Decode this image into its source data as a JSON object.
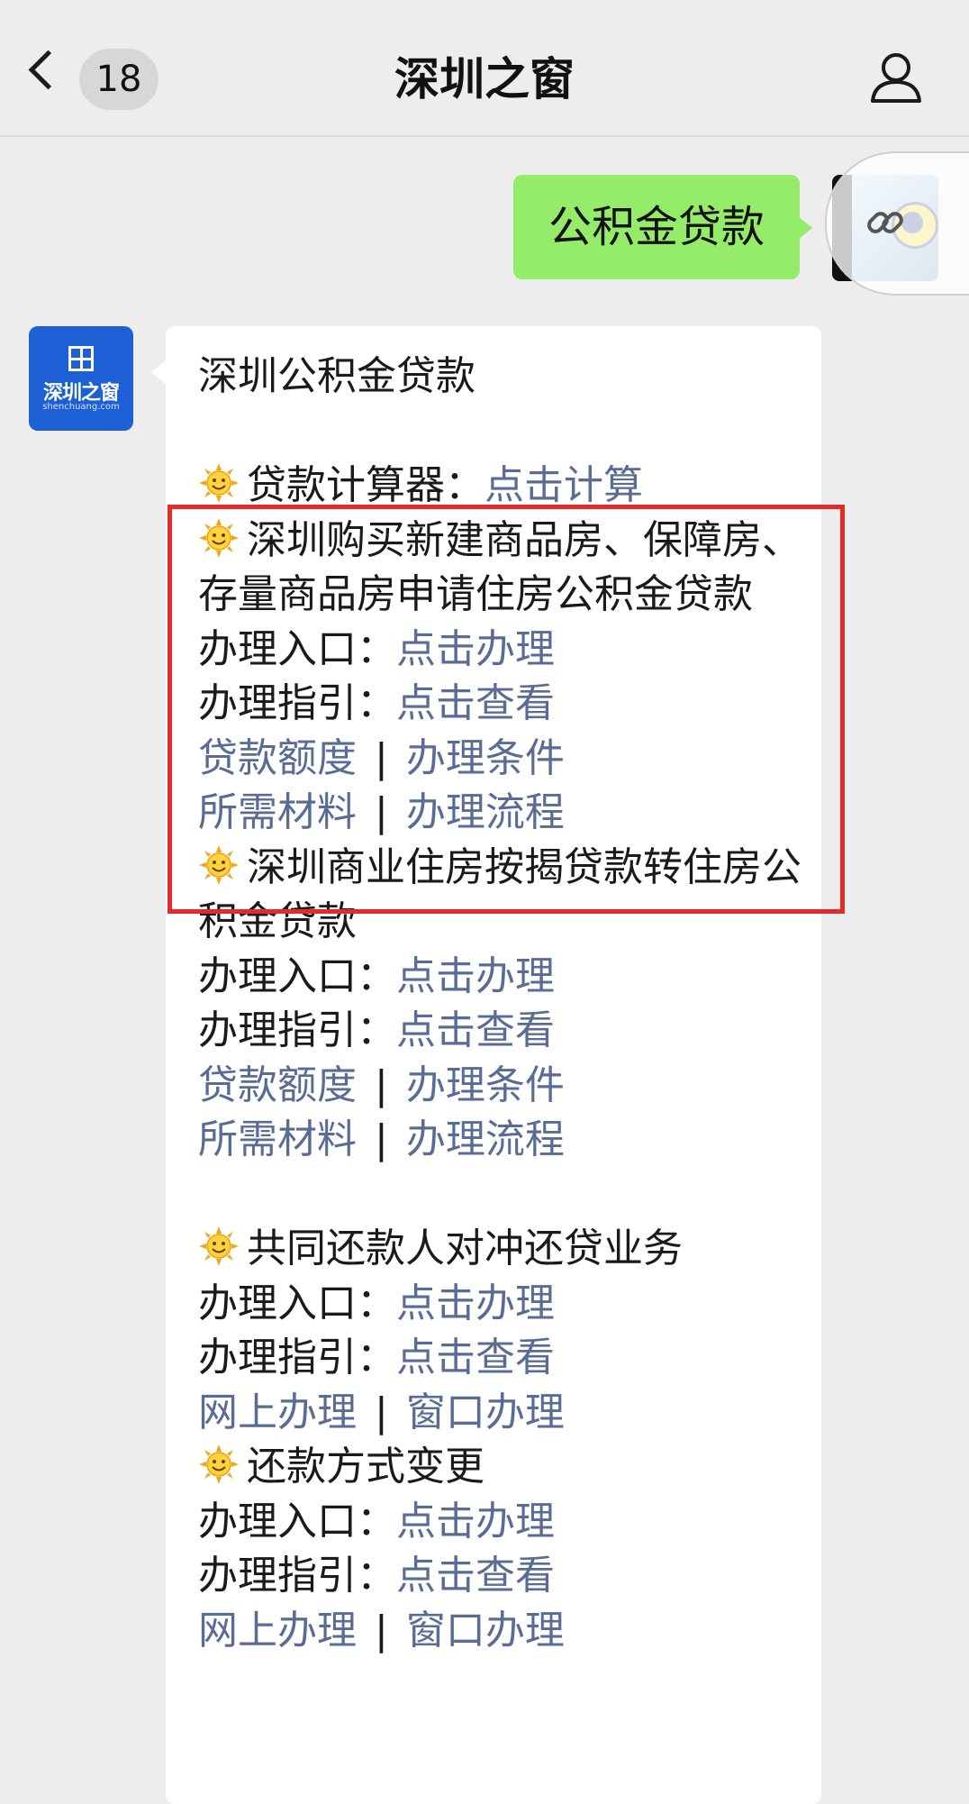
{
  "header": {
    "unread_count": "18",
    "title": "深圳之窗"
  },
  "sent_message": {
    "text": "公积金贷款"
  },
  "bot": {
    "avatar_name": "深圳之窗",
    "avatar_domain": "shenchuang.com"
  },
  "reply": {
    "heading": "深圳公积金贷款",
    "calculator": {
      "label": "贷款计算器：",
      "link": "点击计算"
    },
    "sections": [
      {
        "title": "深圳购买新建商品房、保障房、存量商品房申请住房公积金贷款",
        "entry_label": "办理入口：",
        "entry_link": "点击办理",
        "guide_label": "办理指引：",
        "guide_link": "点击查看",
        "links_row1": [
          "贷款额度",
          "办理条件"
        ],
        "links_row2": [
          "所需材料",
          "办理流程"
        ]
      },
      {
        "title": "深圳商业住房按揭贷款转住房公积金贷款",
        "entry_label": "办理入口：",
        "entry_link": "点击办理",
        "guide_label": "办理指引：",
        "guide_link": "点击查看",
        "links_row1": [
          "贷款额度",
          "办理条件"
        ],
        "links_row2": [
          "所需材料",
          "办理流程"
        ]
      },
      {
        "title": "共同还款人对冲还贷业务",
        "entry_label": "办理入口：",
        "entry_link": "点击办理",
        "guide_label": "办理指引：",
        "guide_link": "点击查看",
        "links_row1": [
          "网上办理",
          "窗口办理"
        ]
      },
      {
        "title": "还款方式变更",
        "entry_label": "办理入口：",
        "entry_link": "点击办理",
        "guide_label": "办理指引：",
        "guide_link": "点击查看",
        "links_row1": [
          "网上办理",
          "窗口办理"
        ]
      }
    ],
    "separator": "|"
  },
  "icons": {
    "back": "chevron-left-icon",
    "profile": "person-icon",
    "bullet": "sun-emoji-icon",
    "link_float": "link-icon"
  },
  "colors": {
    "link": "#586c95",
    "sent_bubble": "#95ec69",
    "highlight": "#e52a2a",
    "background": "#ededed"
  }
}
